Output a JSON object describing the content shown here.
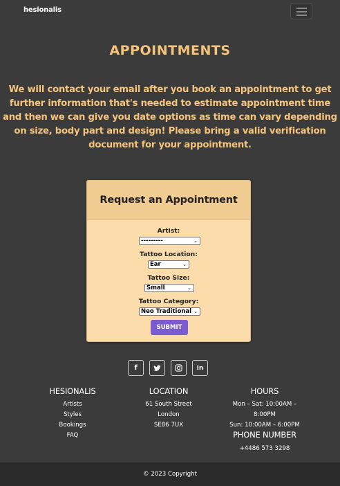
{
  "nav": {
    "brand": "hesionalis",
    "toggle_icon": "hamburger-icon"
  },
  "page": {
    "title": "APPOINTMENTS",
    "intro": "We will contact your email after you book an appointment to get further information that's needed to estimate appointment time and then we can give you date options as time can vary depending on size, body part and design! Please bring a valid verification document for your appointment."
  },
  "form": {
    "title": "Request an Appointment",
    "artist_label": "Artist:",
    "artist_value": "---------",
    "location_label": "Tattoo Location:",
    "location_value": "Ear",
    "size_label": "Tattoo Size:",
    "size_value": "Small",
    "category_label": "Tattoo Category:",
    "category_value": "Neo Traditional",
    "submit_label": "SUBMIT"
  },
  "social": {
    "facebook": "f",
    "twitter": "t",
    "instagram": "◎",
    "linkedin": "in"
  },
  "footer": {
    "brand_title": "HESIONALIS",
    "links": [
      "Artists",
      "Styles",
      "Bookings",
      "FAQ"
    ],
    "location_title": "LOCATION",
    "address": [
      "61 South Street",
      "London",
      "SE86 7UX"
    ],
    "hours_title": "HOURS",
    "hours": [
      "Mon – Sat: 10:00AM –",
      "8:00PM",
      "Sun: 10:00AM – 6:00PM"
    ],
    "phone_title": "PHONE NUMBER",
    "phone": "+4486 573 3298",
    "copyright": "© 2023 Copyright"
  },
  "colors": {
    "background": "#3b3b3b",
    "accent_text": "#f6c37a",
    "card_bg": "#fbdcaa",
    "card_header": "#f0cb92",
    "submit_button": "#7a5bd0",
    "footer_bar": "#2a2a2a"
  }
}
